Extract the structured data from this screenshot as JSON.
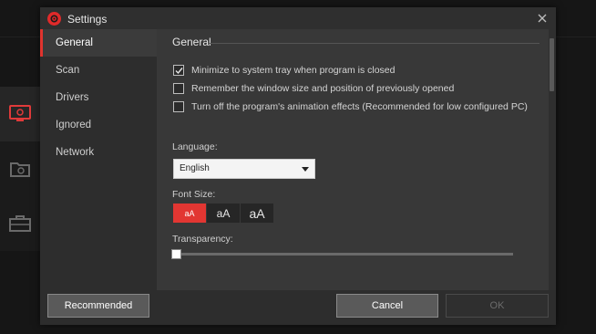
{
  "dialog": {
    "title": "Settings",
    "close_icon": "close-icon"
  },
  "sidebar": {
    "items": [
      {
        "label": "General",
        "active": true
      },
      {
        "label": "Scan",
        "active": false
      },
      {
        "label": "Drivers",
        "active": false
      },
      {
        "label": "Ignored",
        "active": false
      },
      {
        "label": "Network",
        "active": false
      }
    ]
  },
  "general": {
    "section_title": "General",
    "options": [
      {
        "label": "Minimize to system tray when program is closed",
        "checked": true
      },
      {
        "label": "Remember the window size and position of previously opened",
        "checked": false
      },
      {
        "label": "Turn off the program's animation effects (Recommended for low configured PC)",
        "checked": false
      }
    ],
    "language_label": "Language:",
    "language_value": "English",
    "font_size_label": "Font Size:",
    "font_sizes": [
      "aA",
      "aA",
      "aA"
    ],
    "font_size_selected": 0,
    "transparency_label": "Transparency:",
    "transparency_value": 0
  },
  "footer": {
    "recommended_label": "Recommended",
    "cancel_label": "Cancel",
    "ok_label": "OK"
  },
  "colors": {
    "accent": "#e23632",
    "dialog_bg": "#2d2d2d",
    "content_bg": "#383838"
  },
  "background_icons": [
    "monitor-icon",
    "camera-folder-icon",
    "toolbox-icon"
  ]
}
